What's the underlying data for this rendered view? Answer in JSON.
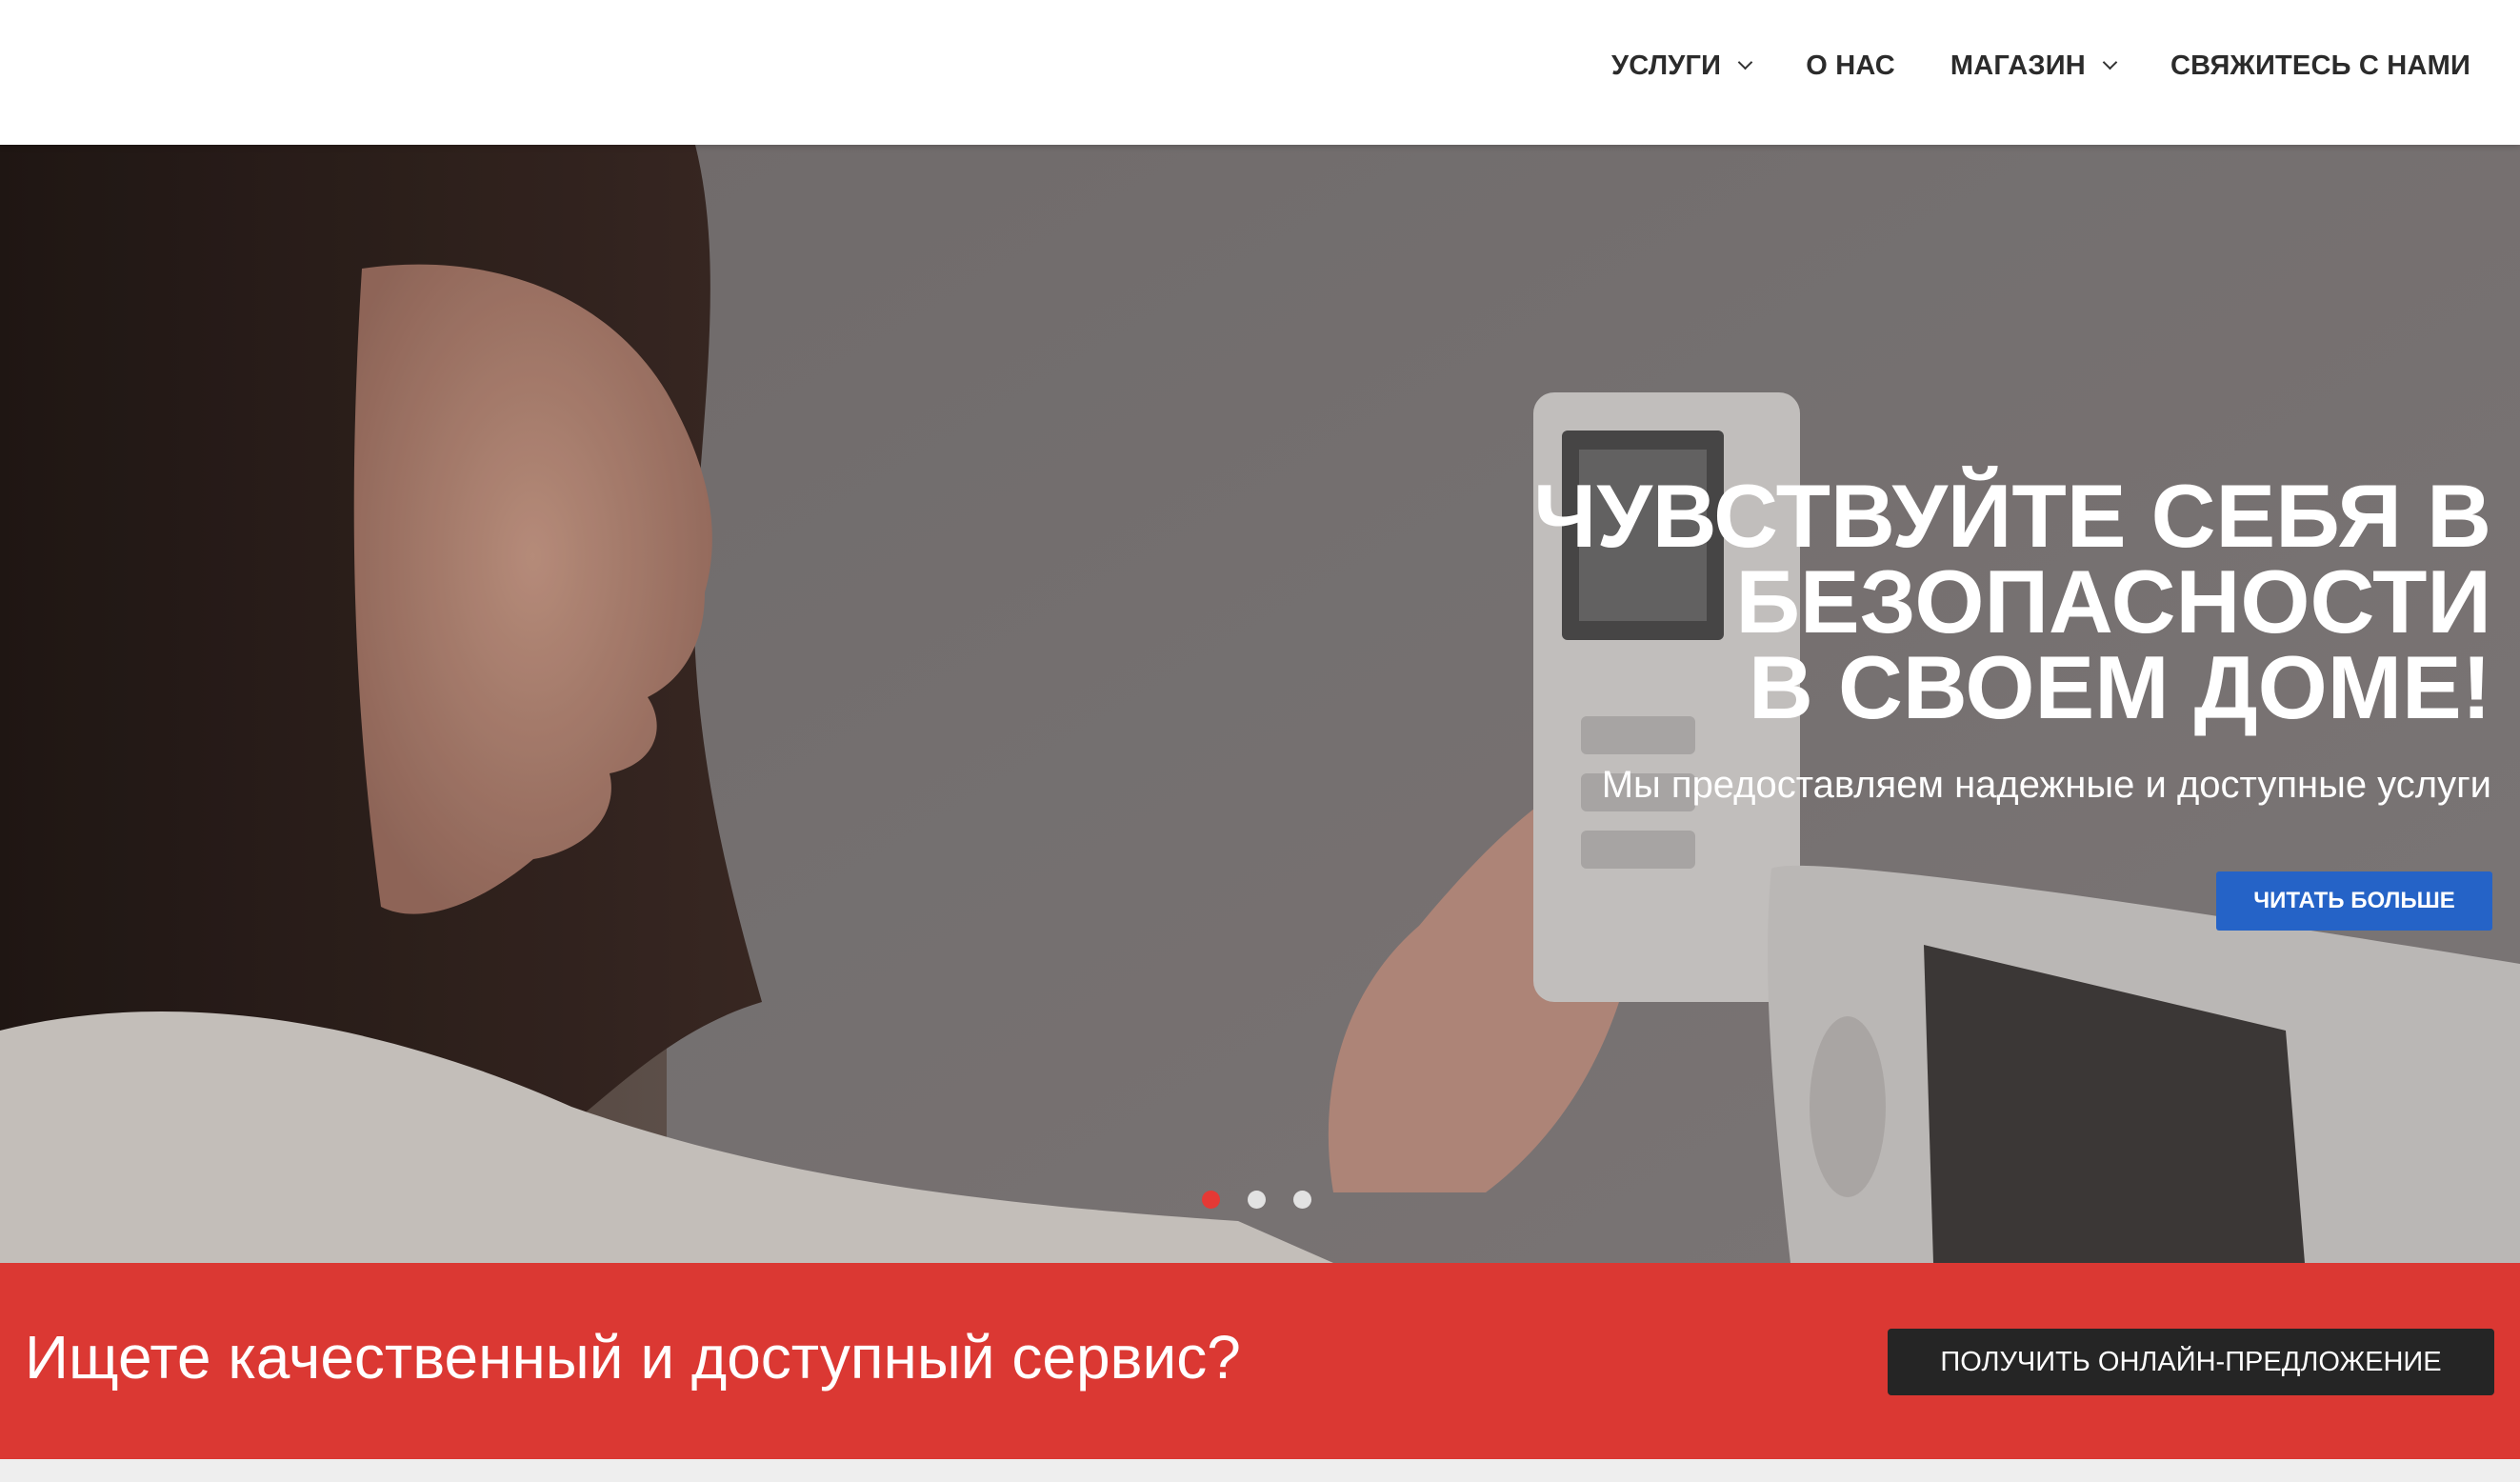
{
  "nav": {
    "items": [
      {
        "label": "УСЛУГИ",
        "has_dropdown": true
      },
      {
        "label": "О НАС",
        "has_dropdown": false
      },
      {
        "label": "МАГАЗИН",
        "has_dropdown": true
      },
      {
        "label": "СВЯЖИТЕСЬ С НАМИ",
        "has_dropdown": false
      }
    ]
  },
  "hero": {
    "title_lines": [
      "ЧУВСТВУЙТЕ СЕБЯ В",
      "БЕЗОПАСНОСТИ",
      "В СВОЕМ ДОМЕ!"
    ],
    "subtitle": "Мы предоставляем надежные и доступные услуги",
    "button_label": "ЧИТАТЬ БОЛЬШЕ",
    "slider": {
      "total": 3,
      "active": 1
    }
  },
  "cta": {
    "text": "Ищете качественный и доступный сервис?",
    "button_label": "ПОЛУЧИТЬ ОНЛАЙН-ПРЕДЛОЖЕНИЕ"
  },
  "colors": {
    "accent_red": "#db3833",
    "button_blue": "#2563c7",
    "dark_button": "#252525",
    "dot_active": "#e53935"
  }
}
